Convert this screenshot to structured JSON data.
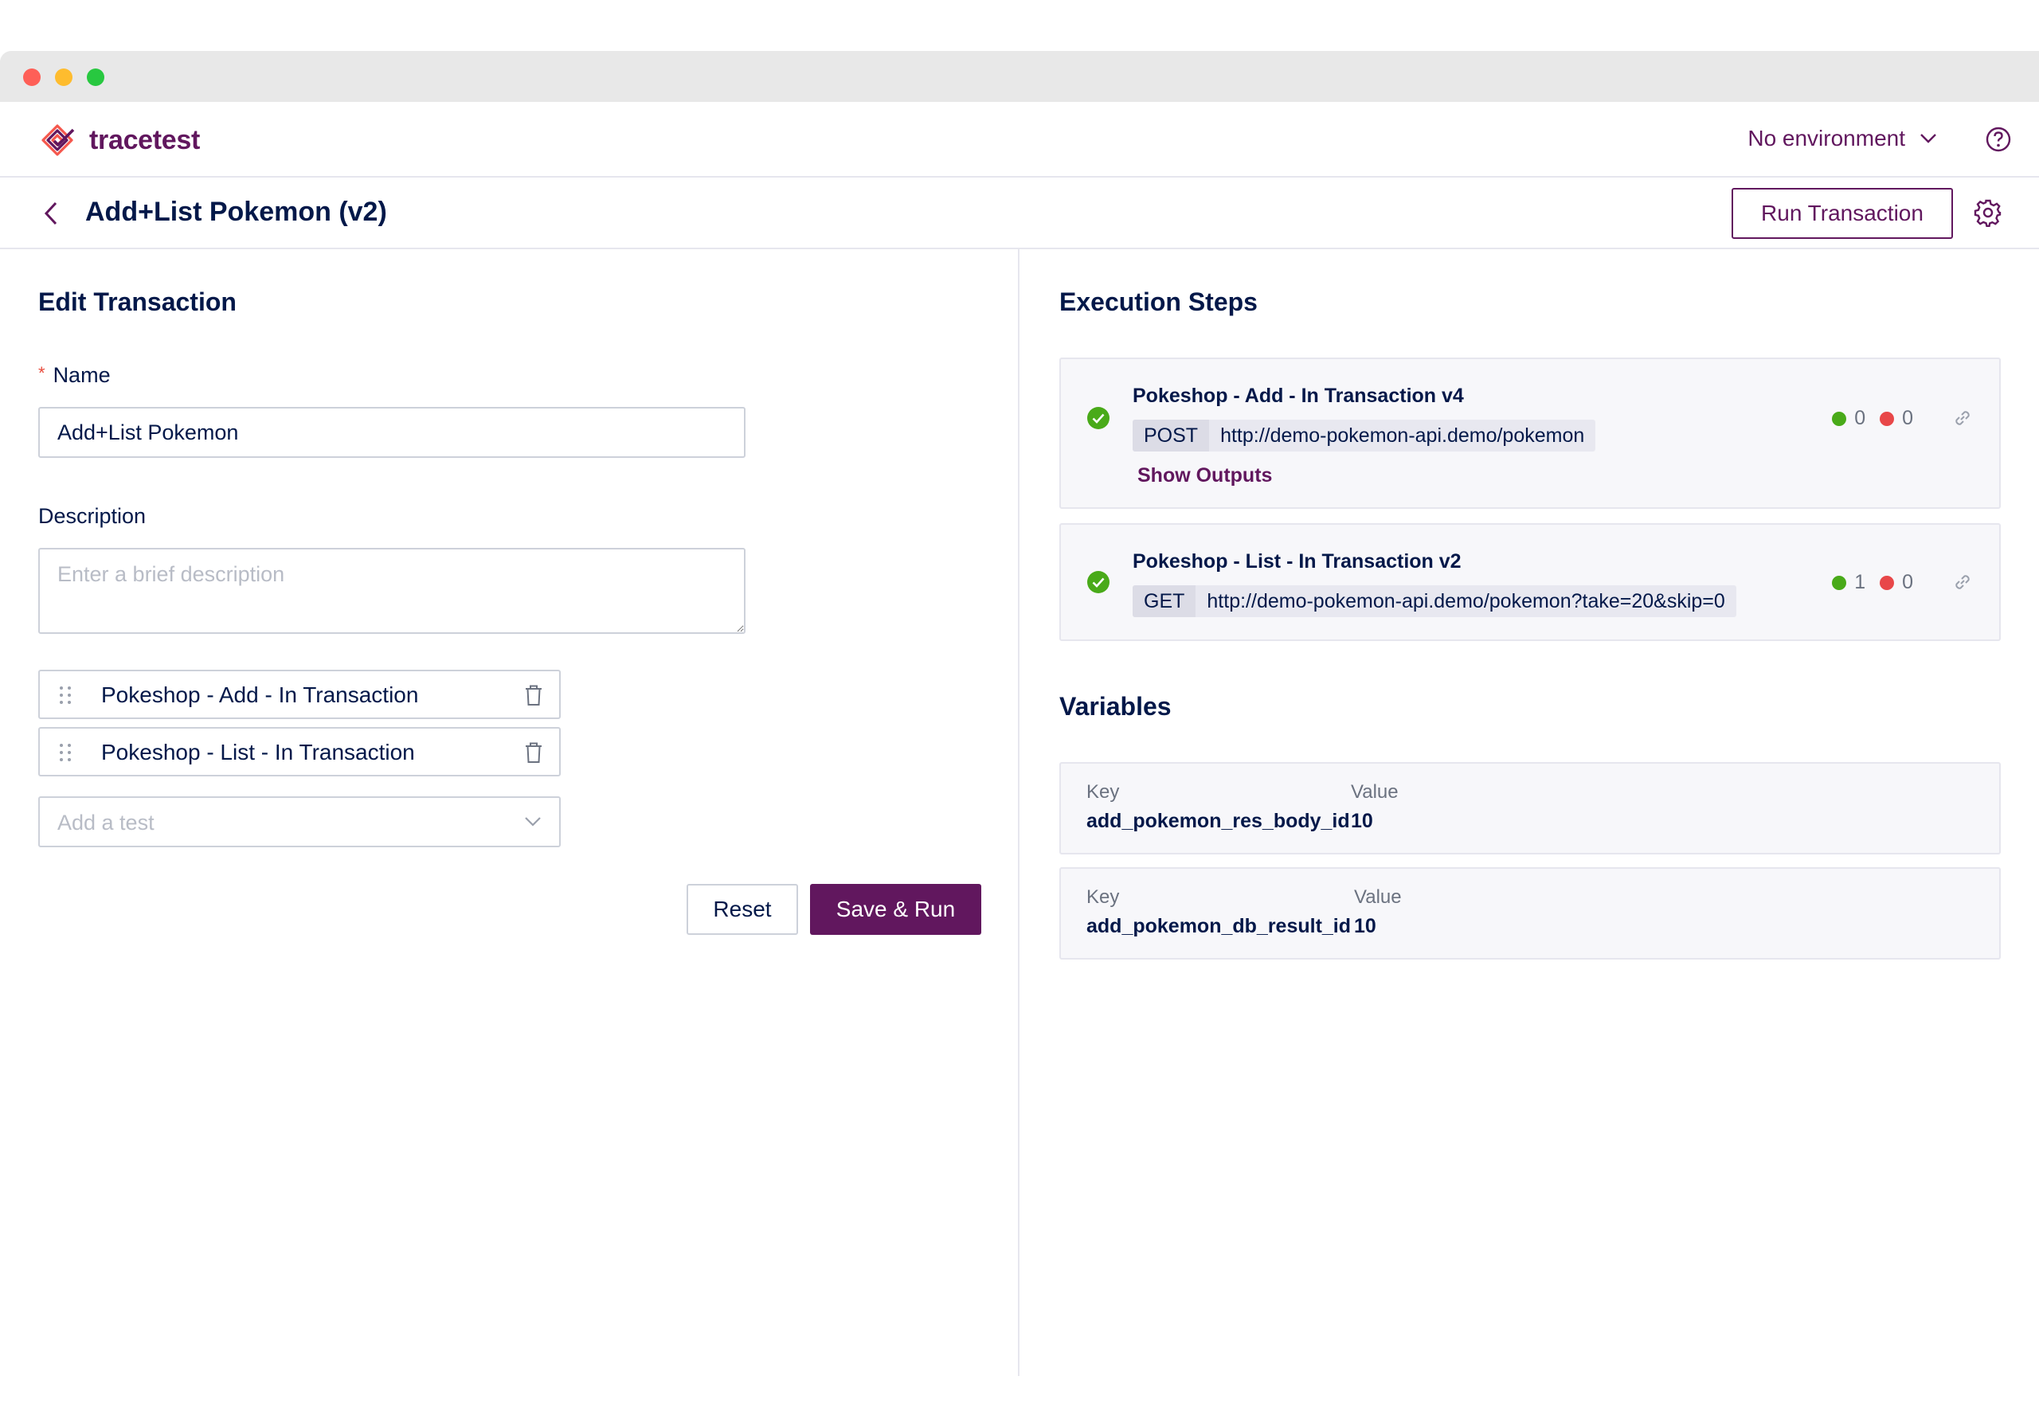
{
  "app": {
    "brand": "tracetest",
    "environment_label": "No environment",
    "accent_color": "#61175e"
  },
  "titlebar": {
    "title": "Add+List Pokemon (v2)",
    "run_button": "Run Transaction"
  },
  "edit": {
    "heading": "Edit Transaction",
    "required_mark": "*",
    "name_label": "Name",
    "name_value": "Add+List Pokemon",
    "description_label": "Description",
    "description_placeholder": "Enter a brief description",
    "tests": [
      {
        "label": "Pokeshop - Add - In Transaction"
      },
      {
        "label": "Pokeshop - List - In Transaction"
      }
    ],
    "add_test_placeholder": "Add a test",
    "reset_button": "Reset",
    "save_button": "Save & Run"
  },
  "execution": {
    "heading": "Execution Steps",
    "steps": [
      {
        "title": "Pokeshop - Add - In Transaction v4",
        "method": "POST",
        "url": "http://demo-pokemon-api.demo/pokemon",
        "passed": "0",
        "failed": "0",
        "show_outputs": "Show Outputs"
      },
      {
        "title": "Pokeshop - List - In Transaction v2",
        "method": "GET",
        "url": "http://demo-pokemon-api.demo/pokemon?take=20&skip=0",
        "passed": "1",
        "failed": "0"
      }
    ]
  },
  "variables": {
    "heading": "Variables",
    "key_label": "Key",
    "value_label": "Value",
    "items": [
      {
        "key": "add_pokemon_res_body_id",
        "value": "10"
      },
      {
        "key": "add_pokemon_db_result_id",
        "value": "10"
      }
    ]
  }
}
